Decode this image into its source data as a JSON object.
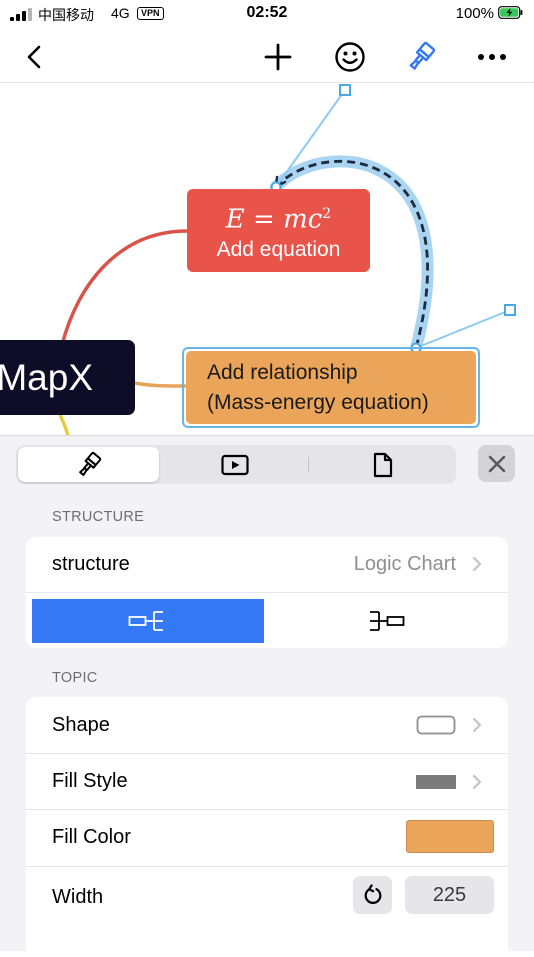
{
  "status_bar": {
    "carrier": "中国移动",
    "network": "4G",
    "vpn": "VPN",
    "time": "02:52",
    "battery_percent": "100%"
  },
  "toolbar": {
    "back_icon": "chevron-left-icon",
    "add_icon": "plus-icon",
    "emoji_icon": "smiley-icon",
    "format_icon": "paint-brush-icon",
    "more_icon": "ellipsis-icon"
  },
  "canvas": {
    "root_topic": "MapX",
    "equation_topic": {
      "formula_main": "E = mc",
      "formula_exp": "2",
      "label": "Add equation"
    },
    "relationship_topic": {
      "line1": "Add relationship",
      "line2": "(Mass-energy equation)"
    }
  },
  "panel": {
    "tabs": [
      {
        "name": "style",
        "icon": "paint-brush-icon",
        "active": true
      },
      {
        "name": "presentation",
        "icon": "play-icon",
        "active": false
      },
      {
        "name": "document",
        "icon": "document-icon",
        "active": false
      }
    ],
    "close_icon": "close-icon",
    "structure_section": {
      "header": "STRUCTURE",
      "structure_label": "structure",
      "structure_value": "Logic Chart",
      "options": [
        "logic-right",
        "logic-left"
      ],
      "selected_option": "logic-right"
    },
    "topic_section": {
      "header": "TOPIC",
      "shape_label": "Shape",
      "fill_style_label": "Fill Style",
      "fill_color_label": "Fill Color",
      "fill_color": "#eba55a",
      "width_label": "Width",
      "width_value": "225"
    }
  },
  "colors": {
    "accent_blue": "#3478f6",
    "equation_node": "#e8544a",
    "relationship_node": "#eba55a",
    "root_node": "#0d0d28",
    "selection": "#69b4e6",
    "branch_red": "#d9534a",
    "branch_orange": "#e6a35a",
    "branch_yellow": "#e8cc3c"
  }
}
